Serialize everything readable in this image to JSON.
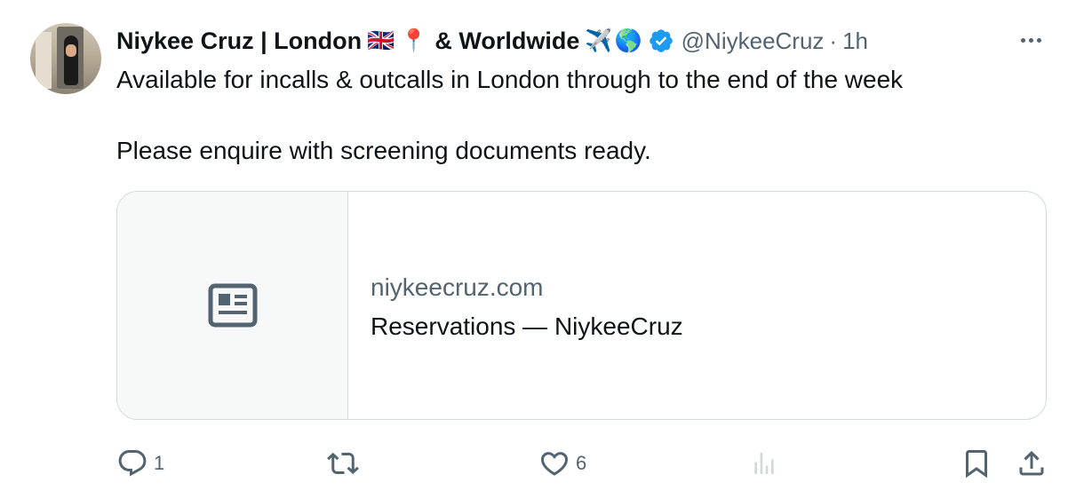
{
  "author": {
    "display_name": "Niykee Cruz | London",
    "flag_emoji": "🇬🇧",
    "pin_emoji": "📍",
    "name_suffix": "& Worldwide",
    "plane_emoji": "✈️",
    "globe_emoji": "🌎",
    "handle": "@NiykeeCruz",
    "separator": "·",
    "timestamp": "1h",
    "verified_color": "#1d9bf0"
  },
  "tweet": {
    "line1": "Available for incalls & outcalls in London through to the end of the week",
    "line2": "Please enquire with screening documents ready."
  },
  "link_card": {
    "domain": "niykeecruz.com",
    "title": "Reservations — NiykeeCruz",
    "thumb_icon": "article-icon"
  },
  "actions": {
    "reply_count": "1",
    "retweet_count": "",
    "like_count": "6",
    "views_count": ""
  },
  "colors": {
    "secondary_text": "#536471",
    "primary_text": "#0f1419",
    "border": "#cfd9de"
  }
}
